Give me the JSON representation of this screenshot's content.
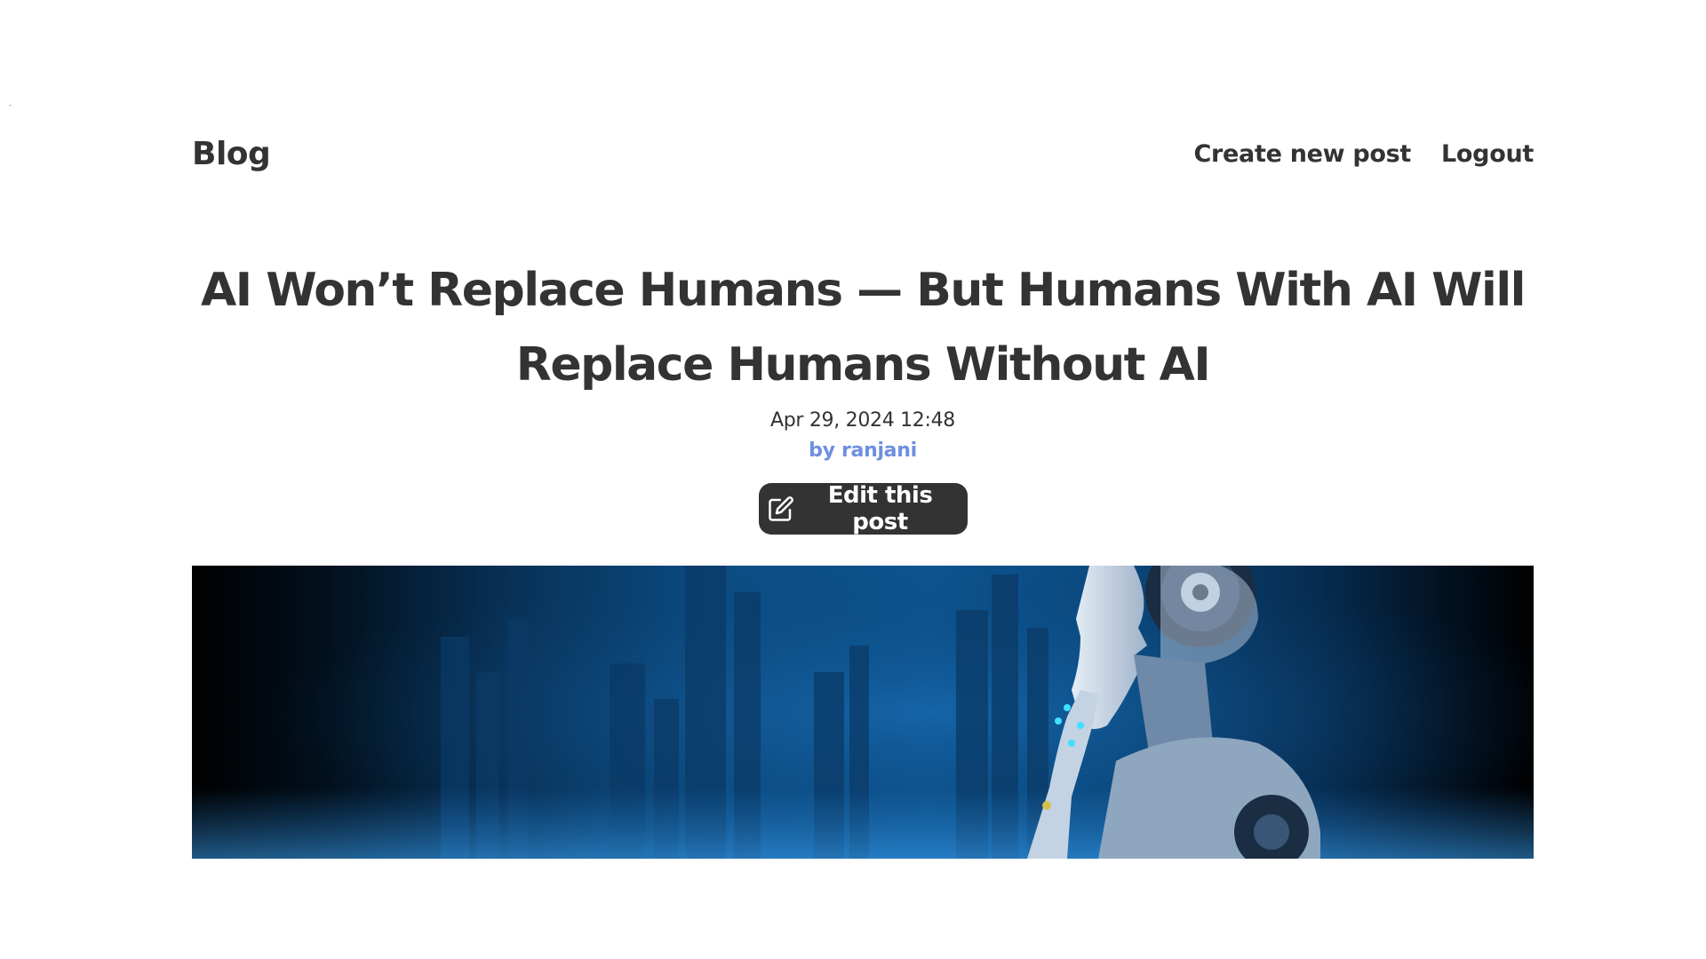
{
  "header": {
    "brand": "Blog",
    "nav": {
      "create_label": "Create new post",
      "logout_label": "Logout"
    }
  },
  "post": {
    "title": "AI Won’t Replace Humans — But Humans With AI Will Replace Humans Without AI",
    "date": "Apr 29, 2024 12:48",
    "author": "by ranjani",
    "edit_label": "Edit this post",
    "edit_icon": "edit-icon",
    "image_alt": "humanoid-robot-thinking"
  },
  "colors": {
    "text": "#333333",
    "author_accent": "#6d8fe0",
    "button_bg": "#333333",
    "button_text": "#ffffff",
    "hero_blue": "#0c4d84"
  }
}
